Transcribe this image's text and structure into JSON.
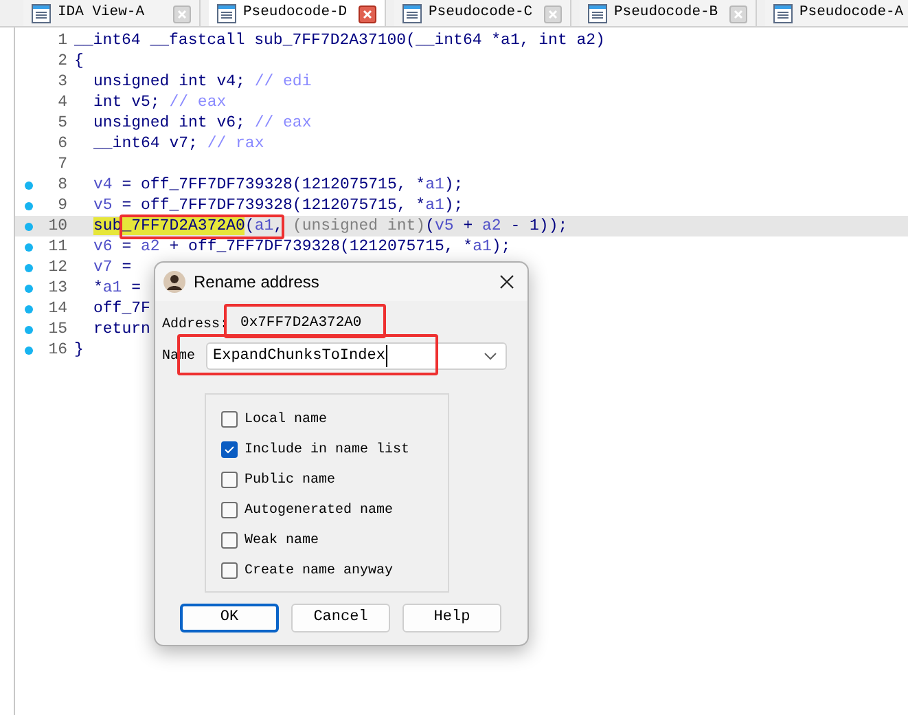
{
  "tabs": [
    {
      "label": "IDA View-A",
      "selected": false
    },
    {
      "label": "Pseudocode-D",
      "selected": true
    },
    {
      "label": "Pseudocode-C",
      "selected": false
    },
    {
      "label": "Pseudocode-B",
      "selected": false
    },
    {
      "label": "Pseudocode-A",
      "selected": false
    }
  ],
  "code": {
    "lines": [
      {
        "number": "1",
        "marked": false,
        "current": false,
        "indented": false,
        "segments": [
          {
            "text": "__int64 __fastcall sub_7FF7D2A37100(__int64 *a1, int a2)",
            "kind": "code"
          }
        ]
      },
      {
        "number": "2",
        "marked": false,
        "current": false,
        "indented": false,
        "segments": [
          {
            "text": "{",
            "kind": "code"
          }
        ]
      },
      {
        "number": "3",
        "marked": false,
        "current": false,
        "indented": true,
        "segments": [
          {
            "text": "unsigned int v4; ",
            "kind": "code"
          },
          {
            "text": "// edi",
            "kind": "comment"
          }
        ]
      },
      {
        "number": "4",
        "marked": false,
        "current": false,
        "indented": true,
        "segments": [
          {
            "text": "int v5; ",
            "kind": "code"
          },
          {
            "text": "// eax",
            "kind": "comment"
          }
        ]
      },
      {
        "number": "5",
        "marked": false,
        "current": false,
        "indented": true,
        "segments": [
          {
            "text": "unsigned int v6; ",
            "kind": "code"
          },
          {
            "text": "// eax",
            "kind": "comment"
          }
        ]
      },
      {
        "number": "6",
        "marked": false,
        "current": false,
        "indented": true,
        "segments": [
          {
            "text": "__int64 v7; ",
            "kind": "code"
          },
          {
            "text": "// rax",
            "kind": "comment"
          }
        ]
      },
      {
        "number": "7",
        "marked": false,
        "current": false
      },
      {
        "number": "8",
        "marked": true,
        "current": false,
        "indented": true,
        "segments": [
          {
            "text": "v4",
            "kind": "var"
          },
          {
            "text": " = off_7FF7DF739328(1212075715, *",
            "kind": "code"
          },
          {
            "text": "a1",
            "kind": "var"
          },
          {
            "text": ");",
            "kind": "code"
          }
        ]
      },
      {
        "number": "9",
        "marked": true,
        "current": false,
        "indented": true,
        "segments": [
          {
            "text": "v5",
            "kind": "var"
          },
          {
            "text": " = off_7FF7DF739328(1212075715, *",
            "kind": "code"
          },
          {
            "text": "a1",
            "kind": "var"
          },
          {
            "text": ");",
            "kind": "code"
          }
        ]
      },
      {
        "number": "10",
        "marked": true,
        "current": true,
        "indented": true,
        "segments": [
          {
            "text": "sub_7FF7D2A372A0",
            "kind": "highlight"
          },
          {
            "text": "(",
            "kind": "code"
          },
          {
            "text": "a1",
            "kind": "var"
          },
          {
            "text": ", ",
            "kind": "code"
          },
          {
            "text": "(unsigned int)",
            "kind": "cast"
          },
          {
            "text": "(",
            "kind": "code"
          },
          {
            "text": "v5",
            "kind": "var"
          },
          {
            "text": " + ",
            "kind": "code"
          },
          {
            "text": "a2",
            "kind": "var"
          },
          {
            "text": " - 1));",
            "kind": "code"
          }
        ]
      },
      {
        "number": "11",
        "marked": true,
        "current": false,
        "indented": true,
        "segments": [
          {
            "text": "v6",
            "kind": "var"
          },
          {
            "text": " = ",
            "kind": "code"
          },
          {
            "text": "a2",
            "kind": "var"
          },
          {
            "text": " + off_7FF7DF739328(1212075715, *",
            "kind": "code"
          },
          {
            "text": "a1",
            "kind": "var"
          },
          {
            "text": ");",
            "kind": "code"
          }
        ]
      },
      {
        "number": "12",
        "marked": true,
        "current": false,
        "indented": true,
        "segments": [
          {
            "text": "v7",
            "kind": "var"
          },
          {
            "text": " =",
            "kind": "code"
          }
        ]
      },
      {
        "number": "13",
        "marked": true,
        "current": false,
        "indented": true,
        "segments": [
          {
            "text": "*",
            "kind": "code"
          },
          {
            "text": "a1",
            "kind": "var"
          },
          {
            "text": " =",
            "kind": "code"
          }
        ]
      },
      {
        "number": "14",
        "marked": true,
        "current": false,
        "indented": true,
        "segments": [
          {
            "text": "off_7F",
            "kind": "code"
          }
        ]
      },
      {
        "number": "15",
        "marked": true,
        "current": false,
        "indented": true,
        "segments": [
          {
            "text": "return",
            "kind": "code"
          }
        ]
      },
      {
        "number": "16",
        "marked": true,
        "current": false,
        "indented": false,
        "segments": [
          {
            "text": "}",
            "kind": "code"
          }
        ]
      }
    ]
  },
  "dialog": {
    "title": "Rename address",
    "address_label": "Address:",
    "address": "0x7FF7D2A372A0",
    "name_label": "Name",
    "name_value": "ExpandChunksToIndex",
    "options": [
      {
        "label": "Local name",
        "checked": false
      },
      {
        "label": "Include in name list",
        "checked": true
      },
      {
        "label": "Public name",
        "checked": false
      },
      {
        "label": "Autogenerated name",
        "checked": false
      },
      {
        "label": "Weak name",
        "checked": false
      },
      {
        "label": "Create name anyway",
        "checked": false
      }
    ],
    "buttons": [
      {
        "label": "OK",
        "default": true
      },
      {
        "label": "Cancel",
        "default": false
      },
      {
        "label": "Help",
        "default": false
      }
    ]
  }
}
